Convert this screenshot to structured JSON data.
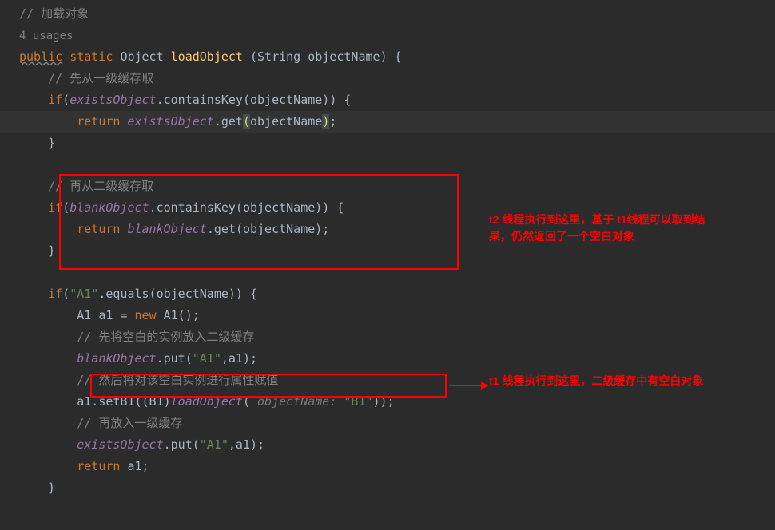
{
  "code": {
    "c1": "// 加载对象",
    "usages": "4 usages",
    "sig_public": "public",
    "sig_static": "static",
    "sig_return": "Object",
    "sig_name": "loadObject",
    "sig_param_type": "String",
    "sig_param_name": "objectName",
    "c2": "// 先从一级缓存取",
    "existsObject": "existsObject",
    "containsKey": ".containsKey(objectName)) {",
    "return_kw": "return",
    "get_call": ".get",
    "objectName": "objectName",
    "c3": "// 再从二级缓存取",
    "blankObject": "blankObject",
    "if_a1_before": "if(",
    "str_a1": "\"A1\"",
    "equals_call": ".equals(objectName)) {",
    "a1_decl": "A1 a1 = ",
    "new_kw": "new",
    "a1_ctor": " A1();",
    "c4": "// 先将空白的实例放入二级缓存",
    "put_a1": ".put(",
    "put_args": ",a1);",
    "c5": "// 然后将对该空白实例进行属性赋值",
    "setb1_call": "a1.setB1((B1)",
    "loadObject_call": "loadObject",
    "param_hint_label": " objectName: ",
    "str_b1": "\"B1\"",
    "close_paren2": "));",
    "c6": "// 再放入一级缓存",
    "return_a1": " a1;"
  },
  "annotations": {
    "a1": "t2 线程执行到这里，基于 t1线程可以取到结果，仍然返回了一个空白对象",
    "a2": "t1 线程执行到这里，二级缓存中有空白对象"
  }
}
